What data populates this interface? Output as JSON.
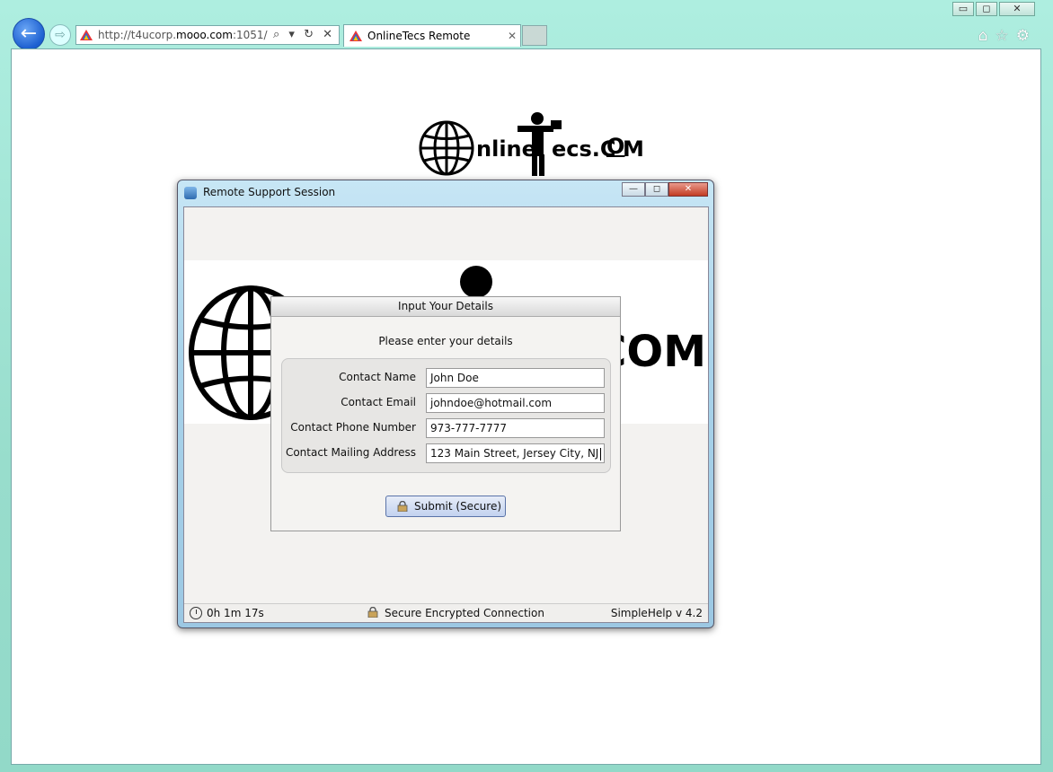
{
  "browser": {
    "url_prefix": "http://t4ucorp.",
    "url_domain": "mooo.com",
    "url_suffix": ":1051/",
    "tab_title": "OnlineTecs Remote Suppor...",
    "address_tools": "⌕ ▾ ↻ ✕",
    "right_tools": "⌂☆⚙",
    "win_min": "▭",
    "win_max": "◻",
    "win_close": "✕"
  },
  "page_logo": {
    "text_left": "nline",
    "text_right": "ecs.C",
    "text_o": "O",
    "text_m": "M"
  },
  "session_window": {
    "title": "Remote Support Session",
    "min": "—",
    "max": "◻",
    "close": "✕",
    "banner_text": "COM"
  },
  "details_dialog": {
    "title": "Input Your Details",
    "prompt": "Please enter your details",
    "fields": [
      {
        "label": "Contact Name",
        "value": "John Doe"
      },
      {
        "label": "Contact Email",
        "value": "johndoe@hotmail.com"
      },
      {
        "label": "Contact Phone Number",
        "value": "973-777-7777"
      },
      {
        "label": "Contact Mailing Address",
        "value": "123 Main Street, Jersey City, NJ"
      }
    ],
    "submit_label": "Submit (Secure)"
  },
  "status": {
    "elapsed": "0h 1m 17s",
    "connection": "Secure Encrypted Connection",
    "version": "SimpleHelp v 4.2"
  }
}
